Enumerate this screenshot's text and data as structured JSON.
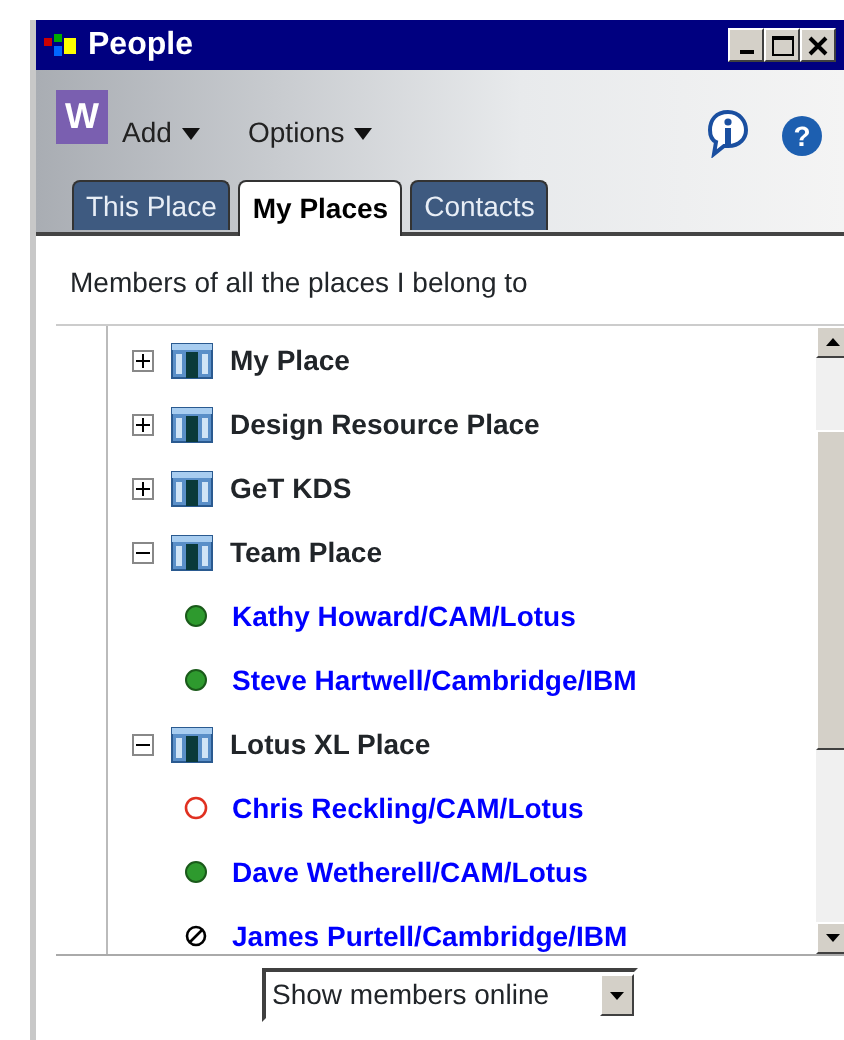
{
  "window": {
    "title": "People"
  },
  "toolbar": {
    "logo": "W",
    "menus": [
      {
        "label": "Add"
      },
      {
        "label": "Options"
      }
    ],
    "help": "?"
  },
  "tabs": [
    {
      "label": "This Place",
      "selected": false
    },
    {
      "label": "My Places",
      "selected": true
    },
    {
      "label": "Contacts",
      "selected": false
    }
  ],
  "description": "Members of all the places I belong to",
  "tree": [
    {
      "label": "My Place",
      "expanded": false
    },
    {
      "label": "Design Resource Place",
      "expanded": false
    },
    {
      "label": "GeT KDS",
      "expanded": false
    },
    {
      "label": "Team Place",
      "expanded": true,
      "children": [
        {
          "label": "Kathy Howard/CAM/Lotus",
          "kind": "online"
        },
        {
          "label": "Steve Hartwell/Cambridge/IBM",
          "kind": "online"
        }
      ]
    },
    {
      "label": "Lotus XL Place",
      "expanded": true,
      "children": [
        {
          "label": "Chris Reckling/CAM/Lotus",
          "kind": "offline"
        },
        {
          "label": "Dave Wetherell/CAM/Lotus",
          "kind": "online"
        },
        {
          "label": "James Purtell/Cambridge/IBM",
          "kind": "dnd"
        }
      ]
    }
  ],
  "filter": {
    "value": "Show members online"
  }
}
